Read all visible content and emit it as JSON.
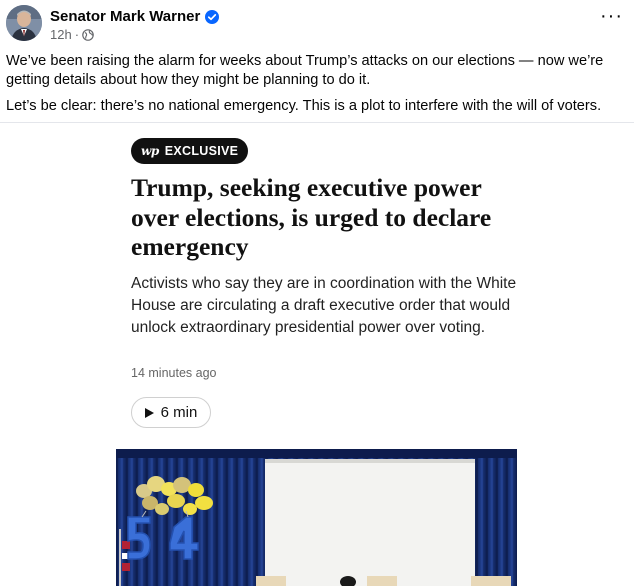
{
  "post": {
    "author": "Senator Mark Warner",
    "time": "12h",
    "separator": "·",
    "more_label": "···",
    "paragraphs": [
      "We’ve been raising the alarm for weeks about Trump’s attacks on our elections — now we’re getting details about how they might be planning to do it.",
      "Let’s be clear: there’s no national emergency. This is a plot to interfere with the will of voters."
    ]
  },
  "article": {
    "badge_logo": "wp",
    "badge_label": "EXCLUSIVE",
    "headline": "Trump, seeking executive power over elections, is urged to declare emergency",
    "subhead": "Activists who say they are in coordination with the White House are circulating a draft executive order that would unlock extraordinary presidential power over voting.",
    "timestamp": "14 minutes ago",
    "audio_duration": "6 min"
  },
  "icons": {
    "verified": "verified-badge-icon",
    "privacy": "globe-icon",
    "more": "more-options-icon",
    "play": "play-icon"
  },
  "colors": {
    "verified_blue": "#0866ff",
    "meta_gray": "#65676b",
    "badge_bg": "#111111",
    "curtain_blue": "#17306e"
  }
}
